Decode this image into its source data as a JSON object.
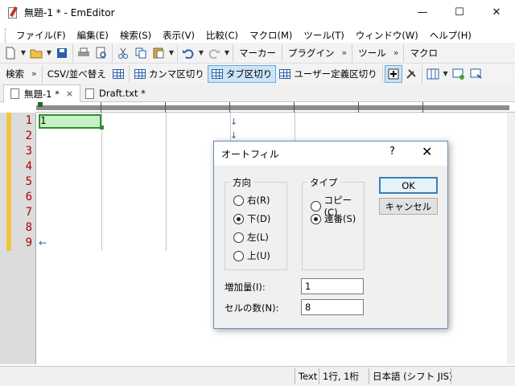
{
  "window": {
    "title": "無題-1 * - EmEditor",
    "minimize_glyph": "—",
    "maximize_glyph": "☐",
    "close_glyph": "✕"
  },
  "menu": [
    "ファイル(F)",
    "編集(E)",
    "検索(S)",
    "表示(V)",
    "比較(C)",
    "マクロ(M)",
    "ツール(T)",
    "ウィンドウ(W)",
    "ヘルプ(H)"
  ],
  "toolbar1": {
    "icons": [
      "new-file-icon",
      "open-folder-icon",
      "save-icon",
      "print-icon",
      "print-preview-icon",
      "cut-icon",
      "copy-icon",
      "paste-icon",
      "undo-icon",
      "redo-icon"
    ],
    "labels": {
      "marker": "マーカー",
      "plugin": "プラグイン",
      "tool": "ツール",
      "macro": "マクロ"
    },
    "chevron": "»"
  },
  "toolbar2": {
    "search": "検索",
    "csv": "CSV/並べ替え",
    "comma": "カンマ区切り",
    "tab": "タブ区切り",
    "user": "ユーザー定義区切り",
    "chevron": "»"
  },
  "tabs": [
    {
      "label": "無題-1 *",
      "close": "×"
    },
    {
      "label": "Draft.txt *"
    }
  ],
  "editor": {
    "line_numbers": [
      "1",
      "2",
      "3",
      "4",
      "5",
      "6",
      "7",
      "8",
      "9"
    ],
    "cell_text": "1",
    "eol_mark": "←",
    "tab_arrow": "↓"
  },
  "statusbar": {
    "mode": "Text",
    "position": "1行, 1桁",
    "encoding": "日本語 (シフト JIS)"
  },
  "dialog": {
    "title": "オートフィル",
    "help": "?",
    "close": "✕",
    "direction": {
      "legend": "方向",
      "options": [
        {
          "label": "右(R)",
          "selected": false
        },
        {
          "label": "下(D)",
          "selected": true
        },
        {
          "label": "左(L)",
          "selected": false
        },
        {
          "label": "上(U)",
          "selected": false
        }
      ]
    },
    "type": {
      "legend": "タイプ",
      "options": [
        {
          "label": "コピー(C)",
          "selected": false
        },
        {
          "label": "連番(S)",
          "selected": true
        }
      ]
    },
    "ok": "OK",
    "cancel": "キャンセル",
    "increment_label": "増加量(I):",
    "increment_value": "1",
    "count_label": "セルの数(N):",
    "count_value": "8"
  }
}
